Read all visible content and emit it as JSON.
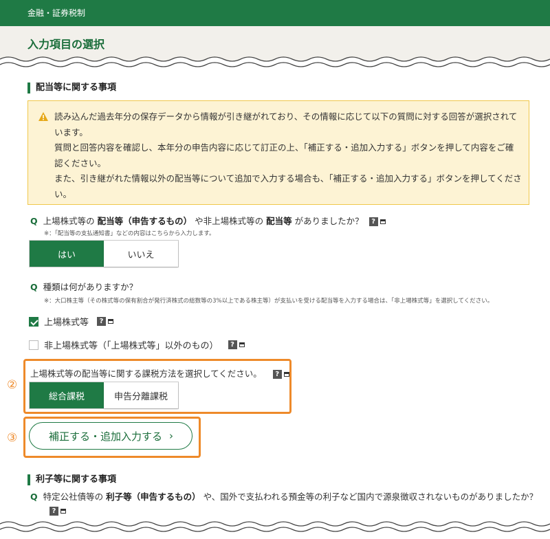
{
  "header": {
    "category": "金融・証券税制",
    "page_title": "入力項目の選択"
  },
  "dividend_section": {
    "heading": "配当等に関する事項",
    "notice": {
      "line1": "読み込んだ過去年分の保存データから情報が引き継がれており、その情報に応じて以下の質問に対する回答が選択されています。",
      "line2": "質問と回答内容を確認し、本年分の申告内容に応じて訂正の上、「補正する・追加入力する」ボタンを押して内容をご確認ください。",
      "line3": "また、引き継がれた情報以外の配当等について追加で入力する場合も、「補正する・追加入力する」ボタンを押してください。"
    },
    "q1": {
      "mark": "Q",
      "part1": "上場株式等の",
      "bold1": "配当等（申告するもの）",
      "part2": "や非上場株式等の",
      "bold2": "配当等",
      "part3": "がありましたか？",
      "note": "※：「配当等の支払通知書」などの内容はこちらから入力します。",
      "options": [
        "はい",
        "いいえ"
      ],
      "selected": "はい"
    },
    "q2": {
      "mark": "Q",
      "text": "種類は何がありますか？",
      "note": "※：大口株主等（その株式等の保有割合が発行済株式の総数等の3%以上である株主等）が支払いを受ける配当等を入力する場合は、「非上場株式等」を選択してください。",
      "checkbox_listed": {
        "label": "上場株式等",
        "checked": true
      },
      "checkbox_unlisted": {
        "label": "非上場株式等（「上場株式等」以外のもの）",
        "checked": false
      }
    },
    "taxation": {
      "prompt": "上場株式等の配当等に関する課税方法を選択してください。",
      "options": [
        "総合課税",
        "申告分離課税"
      ],
      "selected": "総合課税"
    },
    "annotation_2": "②",
    "annotation_3": "③",
    "submit_label": "補正する・追加入力する",
    "submit_chevron": "›"
  },
  "interest_section": {
    "heading": "利子等に関する事項",
    "q": {
      "mark": "Q",
      "part1": "特定公社債等の",
      "bold1": "利子等（申告するもの）",
      "part2": "や、国外で支払われる預金等の利子など国内で源泉徴収されないものがありましたか？"
    }
  },
  "icons": {
    "help": "?",
    "help_icon": "question-mark-icon",
    "popup_icon": "new-window-icon",
    "warning_icon": "warning-triangle-icon"
  },
  "colors": {
    "brand_green": "#1f7a45",
    "accent_orange": "#ee8a2a",
    "notice_bg": "#fdf3d4",
    "notice_border": "#f0c74a"
  }
}
